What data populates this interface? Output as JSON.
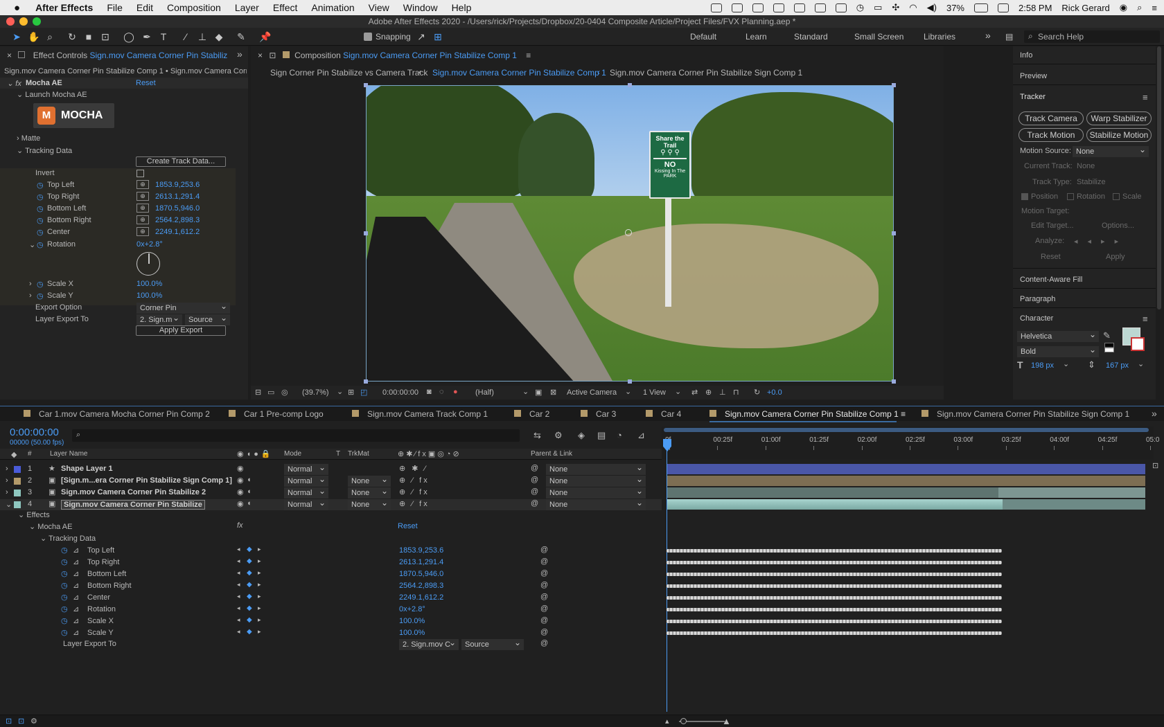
{
  "menubar": {
    "app": "After Effects",
    "items": [
      "File",
      "Edit",
      "Composition",
      "Layer",
      "Effect",
      "Animation",
      "View",
      "Window",
      "Help"
    ],
    "battery": "37%",
    "time": "2:58 PM",
    "user": "Rick Gerard"
  },
  "window_title": "Adobe After Effects 2020 - /Users/rick/Projects/Dropbox/20-0404 Composite Article/Project Files/FVX Planning.aep *",
  "toolbar": {
    "snapping": "Snapping",
    "workspaces": [
      "Default",
      "Learn",
      "Standard",
      "Small Screen",
      "Libraries"
    ],
    "search_placeholder": "Search Help"
  },
  "effect_controls": {
    "tab_prefix": "Effect Controls ",
    "tab_name": "Sign.mov Camera Corner Pin Stabiliz",
    "breadcrumb": "Sign.mov Camera Corner Pin Stabilize Comp 1 • Sign.mov Camera Corne",
    "effect_name": "Mocha AE",
    "reset": "Reset",
    "launch": "Launch Mocha AE",
    "logo_text": "MOCHA",
    "matte": "Matte",
    "tracking_data": "Tracking Data",
    "create_track_data": "Create Track Data...",
    "invert": "Invert",
    "params": [
      {
        "name": "Top Left",
        "value": "1853.9,253.6"
      },
      {
        "name": "Top Right",
        "value": "2613.1,291.4"
      },
      {
        "name": "Bottom Left",
        "value": "1870.5,946.0"
      },
      {
        "name": "Bottom Right",
        "value": "2564.2,898.3"
      },
      {
        "name": "Center",
        "value": "2249.1,612.2"
      }
    ],
    "rotation_label": "Rotation",
    "rotation_value": "0x+2.8°",
    "scale_x_label": "Scale X",
    "scale_x_value": "100.0%",
    "scale_y_label": "Scale Y",
    "scale_y_value": "100.0%",
    "export_option_label": "Export Option",
    "export_option_value": "Corner Pin",
    "layer_export_label": "Layer Export To",
    "layer_export_value": "2. Sign.m",
    "layer_export_source": "Source",
    "apply_export": "Apply Export"
  },
  "composition": {
    "tab_prefix": "Composition ",
    "tab_name": "Sign.mov Camera Corner Pin Stabilize Comp 1",
    "breadcrumbs": [
      "Sign Corner Pin Stabilize vs Camera Track",
      "Sign.mov Camera Corner Pin Stabilize Comp 1",
      "Sign.mov Camera Corner Pin Stabilize Sign Comp 1"
    ],
    "sign": {
      "title": "Share the Trail",
      "no": "NO",
      "line1": "Kissing In The",
      "line2": "PARK"
    },
    "footer": {
      "zoom": "(39.7%)",
      "time": "0:00:00:00",
      "resolution": "(Half)",
      "camera": "Active Camera",
      "views": "1 View",
      "exposure": "+0.0"
    }
  },
  "right_panel": {
    "info": "Info",
    "preview": "Preview",
    "tracker": "Tracker",
    "track_camera": "Track Camera",
    "warp_stabilizer": "Warp Stabilizer",
    "track_motion": "Track Motion",
    "stabilize_motion": "Stabilize Motion",
    "motion_source_label": "Motion Source:",
    "motion_source_value": "None",
    "current_track_label": "Current Track:",
    "current_track_value": "None",
    "track_type_label": "Track Type:",
    "track_type_value": "Stabilize",
    "position": "Position",
    "rotation": "Rotation",
    "scale": "Scale",
    "motion_target": "Motion Target:",
    "edit_target": "Edit Target...",
    "options": "Options...",
    "analyze": "Analyze:",
    "reset": "Reset",
    "apply": "Apply",
    "content_aware_fill": "Content-Aware Fill",
    "paragraph": "Paragraph",
    "character": "Character",
    "font": "Helvetica",
    "style": "Bold",
    "size": "198 px",
    "leading": "167 px"
  },
  "timeline": {
    "tabs": [
      "Car 1.mov Camera Mocha Corner Pin Comp 2",
      "Car 1 Pre-comp Logo",
      "Sign.mov Camera Track Comp 1",
      "Car 2",
      "Car 3",
      "Car 4",
      "Sign.mov Camera Corner Pin Stabilize Comp 1",
      "Sign.mov Camera Corner Pin Stabilize Sign Comp 1"
    ],
    "timecode": "0:00:00:00",
    "frames": "00000 (50.00 fps)",
    "columns": {
      "num": "#",
      "layer_name": "Layer Name",
      "mode": "Mode",
      "t": "T",
      "trkmat": "TrkMat",
      "parent": "Parent & Link"
    },
    "ruler": [
      "0f",
      "00:25f",
      "01:00f",
      "01:25f",
      "02:00f",
      "02:25f",
      "03:00f",
      "03:25f",
      "04:00f",
      "04:25f",
      "05:0"
    ],
    "layers": [
      {
        "num": "1",
        "name": "Shape Layer 1",
        "mode": "Normal",
        "trkmat": "",
        "parent": "None",
        "color": "#4a5bd8",
        "bar": "#4a57a8"
      },
      {
        "num": "2",
        "name": "[Sign.m...era Corner Pin Stabilize Sign Comp 1]",
        "mode": "Normal",
        "trkmat": "None",
        "parent": "None",
        "color": "#b39a6a",
        "bar": "#7d6e53"
      },
      {
        "num": "3",
        "name": "Sign.mov Camera Corner Pin Stabilize 2",
        "mode": "Normal",
        "trkmat": "None",
        "parent": "None",
        "color": "#8fc8c0",
        "bar": "#5e7470"
      },
      {
        "num": "4",
        "name": "Sign.mov Camera Corner Pin Stabilize",
        "mode": "Normal",
        "trkmat": "None",
        "parent": "None",
        "color": "#8fc8c0",
        "bar": "#6d8a86"
      }
    ],
    "effects": "Effects",
    "mocha": "Mocha AE",
    "reset": "Reset",
    "tracking_data": "Tracking Data",
    "props": [
      {
        "name": "Top Left",
        "value": "1853.9,253.6"
      },
      {
        "name": "Top Right",
        "value": "2613.1,291.4"
      },
      {
        "name": "Bottom Left",
        "value": "1870.5,946.0"
      },
      {
        "name": "Bottom Right",
        "value": "2564.2,898.3"
      },
      {
        "name": "Center",
        "value": "2249.1,612.2"
      },
      {
        "name": "Rotation",
        "value": "0x+2.8°"
      },
      {
        "name": "Scale X",
        "value": "100.0%"
      },
      {
        "name": "Scale Y",
        "value": "100.0%"
      }
    ],
    "layer_export_label": "Layer Export To",
    "layer_export_value": "2. Sign.mov C",
    "layer_export_source": "Source"
  }
}
